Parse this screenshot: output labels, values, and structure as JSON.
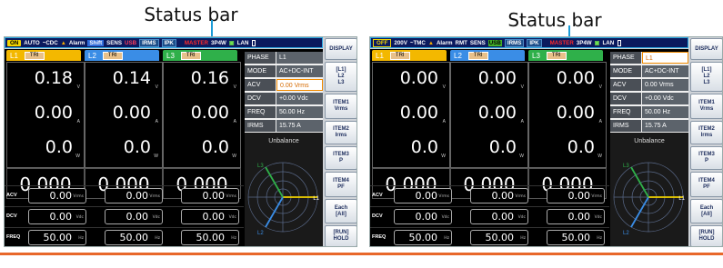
{
  "captions": [
    "Status bar",
    "Status bar"
  ],
  "screens": [
    {
      "status": {
        "out_state": "ON",
        "range": "AUTO",
        "coupling": "~CDC",
        "alarm": "Alarm",
        "shift": "Shift",
        "sens": "SENS",
        "usb": "USB",
        "irms": "IRMS",
        "ipk": "IPK",
        "master": "MASTER",
        "wiring": "3P4W",
        "lan": "LAN"
      },
      "tabs": [
        {
          "name": "L1",
          "tag": "TRI",
          "color": "#f3b800"
        },
        {
          "name": "L2",
          "tag": "TRI",
          "color": "#3a8de6"
        },
        {
          "name": "L3",
          "tag": "TRI",
          "color": "#2fb04a"
        }
      ],
      "channels": [
        {
          "v": "0.18",
          "i": "0.00",
          "p": "0.0",
          "pf": "0.000"
        },
        {
          "v": "0.14",
          "i": "0.00",
          "p": "0.0",
          "pf": "0.000"
        },
        {
          "v": "0.16",
          "i": "0.00",
          "p": "0.0",
          "pf": "0.000"
        }
      ],
      "units": {
        "v": "V",
        "i": "A",
        "p": "W"
      },
      "summary": {
        "rows": [
          "ACV",
          "DCV",
          "FREQ"
        ],
        "units": [
          "Vrms",
          "Vdc",
          "Hz"
        ],
        "values": [
          [
            "0.00",
            "0.00",
            "0.00"
          ],
          [
            "0.00",
            "0.00",
            "0.00"
          ],
          [
            "50.00",
            "50.00",
            "50.00"
          ]
        ]
      },
      "params": [
        {
          "k": "PHASE",
          "v": "L1"
        },
        {
          "k": "MODE",
          "v": "AC+DC-INT"
        },
        {
          "k": "ACV",
          "v": "0.00 Vrms",
          "hl": true
        },
        {
          "k": "DCV",
          "v": "+0.00 Vdc"
        },
        {
          "k": "FREQ",
          "v": "50.00 Hz"
        },
        {
          "k": "IRMS",
          "v": "15.75 A"
        }
      ],
      "unbalance": "Unbalance",
      "phasor": {
        "l1": "L1",
        "l2": "L2",
        "l3": "L3"
      },
      "softkeys": [
        "DISPLAY",
        "[L1]\nL2\nL3",
        "ITEM1\nVrms",
        "ITEM2\nIrms",
        "ITEM3\nP",
        "ITEM4\nPF",
        "Each\n[All]",
        "[RUN]\nHOLD"
      ]
    },
    {
      "status": {
        "out_state": "OFF",
        "range": "200V",
        "coupling": "~TMC",
        "alarm": "Alarm",
        "shift": "RMT",
        "sens": "SENS",
        "usb": "USB",
        "irms": "IRMS",
        "ipk": "IPK",
        "master": "MASTER",
        "wiring": "3P4W",
        "lan": "LAN"
      },
      "tabs": [
        {
          "name": "L1",
          "tag": "TRI",
          "color": "#f3b800"
        },
        {
          "name": "L2",
          "tag": "TRI",
          "color": "#3a8de6"
        },
        {
          "name": "L3",
          "tag": "TRI",
          "color": "#2fb04a"
        }
      ],
      "channels": [
        {
          "v": "0.00",
          "i": "0.00",
          "p": "0.0",
          "pf": "0.000"
        },
        {
          "v": "0.00",
          "i": "0.00",
          "p": "0.0",
          "pf": "0.000"
        },
        {
          "v": "0.00",
          "i": "0.00",
          "p": "0.0",
          "pf": "0.000"
        }
      ],
      "units": {
        "v": "V",
        "i": "A",
        "p": "W"
      },
      "summary": {
        "rows": [
          "ACV",
          "DCV",
          "FREQ"
        ],
        "units": [
          "Vrms",
          "Vdc",
          "Hz"
        ],
        "values": [
          [
            "0.00",
            "0.00",
            "0.00"
          ],
          [
            "0.00",
            "0.00",
            "0.00"
          ],
          [
            "50.00",
            "50.00",
            "50.00"
          ]
        ]
      },
      "params": [
        {
          "k": "PHASE",
          "v": "L1",
          "hl": true
        },
        {
          "k": "MODE",
          "v": "AC+DC-INT"
        },
        {
          "k": "ACV",
          "v": "0.00 Vrms"
        },
        {
          "k": "DCV",
          "v": "+0.00 Vdc"
        },
        {
          "k": "FREQ",
          "v": "50.00 Hz"
        },
        {
          "k": "IRMS",
          "v": "15.75 A"
        }
      ],
      "unbalance": "Unbalance",
      "phasor": {
        "l1": "L1",
        "l2": "L2",
        "l3": "L3"
      },
      "softkeys": [
        "DISPLAY",
        "[L1]\nL2\nL3",
        "ITEM1\nVrms",
        "ITEM2\nIrms",
        "ITEM3\nP",
        "ITEM4\nPF",
        "Each\n[All]",
        "[RUN]\nHOLD"
      ]
    }
  ],
  "colors": {
    "accent_rule": "#e8672a",
    "caption_line": "#1a9bd7"
  }
}
